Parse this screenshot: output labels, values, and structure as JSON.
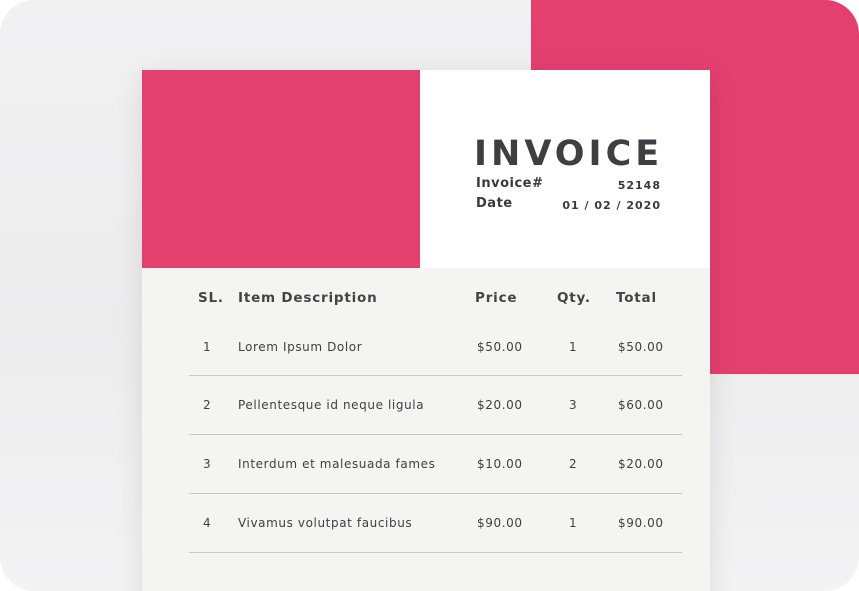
{
  "invoice": {
    "title": "INVOICE",
    "invoice_label": "Invoice#",
    "invoice_number": "52148",
    "date_label": "Date",
    "date_value": "01 / 02 / 2020"
  },
  "table": {
    "headers": [
      "SL.",
      "Item Description",
      "Price",
      "Qty.",
      "Total"
    ],
    "rows": [
      {
        "sl": "1",
        "description": "Lorem Ipsum Dolor",
        "price": "$50.00",
        "qty": "1",
        "total": "$50.00"
      },
      {
        "sl": "2",
        "description": "Pellentesque id neque ligula",
        "price": "$20.00",
        "qty": "3",
        "total": "$60.00"
      },
      {
        "sl": "3",
        "description": "Interdum et malesuada fames",
        "price": "$10.00",
        "qty": "2",
        "total": "$20.00"
      },
      {
        "sl": "4",
        "description": "Vivamus volutpat faucibus",
        "price": "$90.00",
        "qty": "1",
        "total": "$90.00"
      }
    ]
  },
  "colors": {
    "accent": "#e34070",
    "text": "#3f3f42",
    "sheet": "#f4f4f3"
  }
}
